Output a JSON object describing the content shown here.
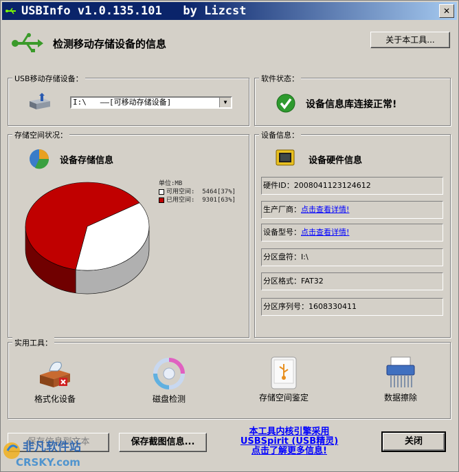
{
  "window": {
    "title": "USBInfo v1.0.135.101   by Lizcst",
    "close_label": "✕"
  },
  "header": {
    "title": "检测移动存储设备的信息",
    "about_button": "关于本工具..."
  },
  "usb_group": {
    "label": "USB移动存储设备：",
    "selected_device": "I:\\   ——[可移动存储设备]"
  },
  "status_group": {
    "label": "软件状态：",
    "text": "设备信息库连接正常!"
  },
  "storage_group": {
    "label": "存储空间状况：",
    "title": "设备存储信息",
    "unit": "单位:MB",
    "free_label": "可用空间:",
    "free_value": "5464[37%]",
    "used_label": "已用空间:",
    "used_value": "9301[63%]"
  },
  "chart_data": {
    "type": "pie",
    "categories": [
      "可用空间",
      "已用空间"
    ],
    "values": [
      5464,
      9301
    ],
    "colors": [
      "#ffffff",
      "#c00000"
    ]
  },
  "hardware_group": {
    "label": "设备信息：",
    "title": "设备硬件信息",
    "rows": [
      {
        "label": "硬件ID：",
        "value": "2008041123124612",
        "link": false
      },
      {
        "label": "生产厂商：",
        "value": "点击查看详情!",
        "link": true
      },
      {
        "label": "设备型号：",
        "value": "点击查看详情!",
        "link": true
      },
      {
        "label": "分区盘符：",
        "value": "I:\\",
        "link": false
      },
      {
        "label": "分区格式：",
        "value": "FAT32",
        "link": false
      },
      {
        "label": "分区序列号：",
        "value": "1608330411",
        "link": false
      }
    ]
  },
  "tools_group": {
    "label": "实用工具：",
    "tools": [
      "格式化设备",
      "磁盘检测",
      "存储空间鉴定",
      "数据擦除"
    ]
  },
  "footer": {
    "save_text_button": "保存信息到文本",
    "save_image_button": "保存截图信息...",
    "link_line1": "本工具内核引擎采用",
    "link_line2": "USBSpirit (USB精灵)",
    "link_line3": "点击了解更多信息!",
    "close_button": "关闭"
  },
  "watermark": {
    "line1": "非凡软件站",
    "line2": "CRSKY.com"
  }
}
